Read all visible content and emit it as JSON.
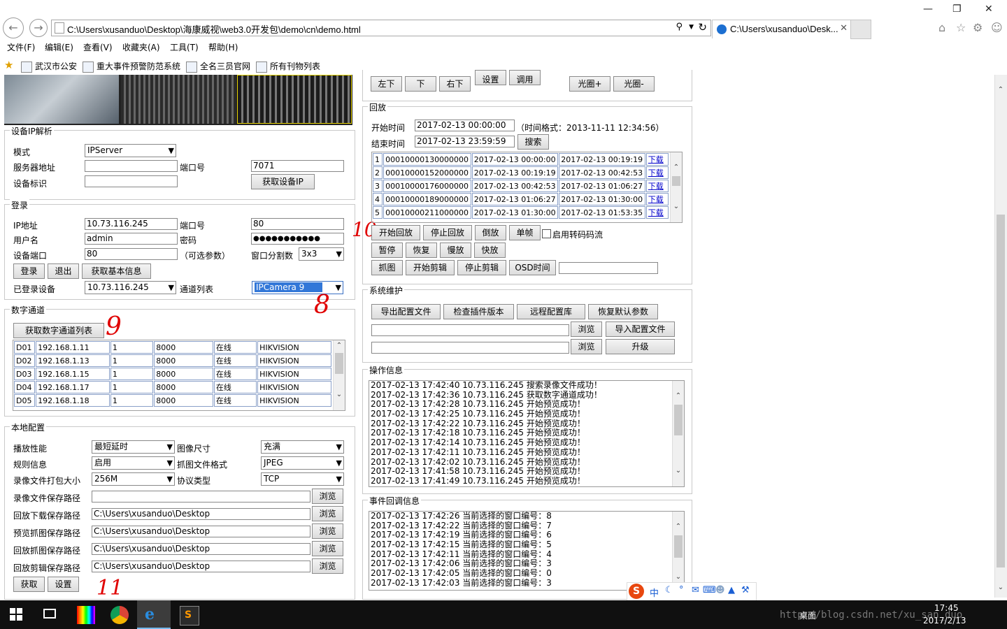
{
  "browser": {
    "address": "C:\\Users\\xusanduo\\Desktop\\海康威视\\web3.0开发包\\demo\\cn\\demo.html",
    "tab_title": "C:\\Users\\xusanduo\\Desk...",
    "menu": [
      "文件(F)",
      "编辑(E)",
      "查看(V)",
      "收藏夹(A)",
      "工具(T)",
      "帮助(H)"
    ],
    "favorites": [
      "武汉市公安",
      "重大事件预警防范系统",
      "全名三员官网",
      "所有刊物列表"
    ]
  },
  "ip_section": {
    "legend": "设备IP解析",
    "mode_label": "模式",
    "mode_value": "IPServer",
    "server_label": "服务器地址",
    "port_label": "端口号",
    "port_value": "7071",
    "device_id_label": "设备标识",
    "get_ip_button": "获取设备IP"
  },
  "login": {
    "legend": "登录",
    "ip_label": "IP地址",
    "ip_value": "10.73.116.245",
    "port_label": "端口号",
    "port_value": "80",
    "user_label": "用户名",
    "user_value": "admin",
    "password_label": "密码",
    "password_value": "●●●●●●●●●●●",
    "device_port_label": "设备端口",
    "device_port_value": "80",
    "optional_note": "（可选参数）",
    "window_split_label": "窗口分割数",
    "window_split_value": "3x3",
    "login_button": "登录",
    "logout_button": "退出",
    "basic_info_button": "获取基本信息",
    "logged_device_label": "已登录设备",
    "logged_device_value": "10.73.116.245",
    "channel_list_label": "通道列表",
    "channel_value": "IPCamera 9"
  },
  "digital_channels": {
    "legend": "数字通道",
    "get_list_button": "获取数字通道列表",
    "rows": [
      [
        "D01",
        "192.168.1.11",
        "1",
        "8000",
        "在线",
        "HIKVISION"
      ],
      [
        "D02",
        "192.168.1.13",
        "1",
        "8000",
        "在线",
        "HIKVISION"
      ],
      [
        "D03",
        "192.168.1.15",
        "1",
        "8000",
        "在线",
        "HIKVISION"
      ],
      [
        "D04",
        "192.168.1.17",
        "1",
        "8000",
        "在线",
        "HIKVISION"
      ],
      [
        "D05",
        "192.168.1.18",
        "1",
        "8000",
        "在线",
        "HIKVISION"
      ]
    ]
  },
  "local_config": {
    "legend": "本地配置",
    "play_perf_label": "播放性能",
    "play_perf_value": "最短延时",
    "image_size_label": "图像尺寸",
    "image_size_value": "充满",
    "rule_info_label": "规则信息",
    "rule_info_value": "启用",
    "capture_format_label": "抓图文件格式",
    "capture_format_value": "JPEG",
    "record_pack_label": "录像文件打包大小",
    "record_pack_value": "256M",
    "protocol_label": "协议类型",
    "protocol_value": "TCP",
    "paths": [
      {
        "label": "录像文件保存路径",
        "value": ""
      },
      {
        "label": "回放下载保存路径",
        "value": "C:\\Users\\xusanduo\\Desktop"
      },
      {
        "label": "预览抓图保存路径",
        "value": "C:\\Users\\xusanduo\\Desktop"
      },
      {
        "label": "回放抓图保存路径",
        "value": "C:\\Users\\xusanduo\\Desktop"
      },
      {
        "label": "回放剪辑保存路径",
        "value": "C:\\Users\\xusanduo\\Desktop"
      }
    ],
    "browse_button": "浏览",
    "get_button": "获取",
    "set_button": "设置"
  },
  "ptz": {
    "left_down": "左下",
    "down": "下",
    "right_down": "右下",
    "set": "设置",
    "call": "调用",
    "iris_plus": "光圈+",
    "iris_minus": "光圈-"
  },
  "playback": {
    "legend": "回放",
    "start_label": "开始时间",
    "start_value": "2017-02-13 00:00:00",
    "format_note": "（时间格式：2013-11-11 12:34:56）",
    "end_label": "结束时间",
    "end_value": "2017-02-13 23:59:59",
    "search_button": "搜索",
    "download_label": "下载",
    "rows": [
      [
        "1",
        "00010000130000000",
        "2017-02-13 00:00:00",
        "2017-02-13 00:19:19"
      ],
      [
        "2",
        "00010000152000000",
        "2017-02-13 00:19:19",
        "2017-02-13 00:42:53"
      ],
      [
        "3",
        "00010000176000000",
        "2017-02-13 00:42:53",
        "2017-02-13 01:06:27"
      ],
      [
        "4",
        "00010000189000000",
        "2017-02-13 01:06:27",
        "2017-02-13 01:30:00"
      ],
      [
        "5",
        "00010000211000000",
        "2017-02-13 01:30:00",
        "2017-02-13 01:53:35"
      ]
    ],
    "start_playback": "开始回放",
    "stop_playback": "停止回放",
    "reverse": "倒放",
    "single_frame": "单帧",
    "transcode_label": "启用转码码流",
    "pause": "暂停",
    "resume": "恢复",
    "slow": "慢放",
    "fast": "快放",
    "capture": "抓图",
    "start_clip": "开始剪辑",
    "stop_clip": "停止剪辑",
    "osd_time": "OSD时间"
  },
  "maintenance": {
    "legend": "系统维护",
    "export_config": "导出配置文件",
    "check_plugin": "检查插件版本",
    "remote_config": "远程配置库",
    "restore_default": "恢复默认参数",
    "browse": "浏览",
    "import_config": "导入配置文件",
    "upgrade": "升级"
  },
  "op_info": {
    "legend": "操作信息",
    "lines": [
      "2017-02-13 17:42:40 10.73.116.245 搜索录像文件成功！",
      "2017-02-13 17:42:36 10.73.116.245 获取数字通道成功！",
      "2017-02-13 17:42:28 10.73.116.245 开始预览成功！",
      "2017-02-13 17:42:25 10.73.116.245 开始预览成功！",
      "2017-02-13 17:42:22 10.73.116.245 开始预览成功！",
      "2017-02-13 17:42:18 10.73.116.245 开始预览成功！",
      "2017-02-13 17:42:14 10.73.116.245 开始预览成功！",
      "2017-02-13 17:42:11 10.73.116.245 开始预览成功！",
      "2017-02-13 17:42:02 10.73.116.245 开始预览成功！",
      "2017-02-13 17:41:58 10.73.116.245 开始预览成功！",
      "2017-02-13 17:41:49 10.73.116.245 开始预览成功！"
    ]
  },
  "event_info": {
    "legend": "事件回调信息",
    "lines": [
      "2017-02-13 17:42:26 当前选择的窗口编号：8",
      "2017-02-13 17:42:22 当前选择的窗口编号：7",
      "2017-02-13 17:42:19 当前选择的窗口编号：6",
      "2017-02-13 17:42:15 当前选择的窗口编号：5",
      "2017-02-13 17:42:11 当前选择的窗口编号：4",
      "2017-02-13 17:42:06 当前选择的窗口编号：3",
      "2017-02-13 17:42:05 当前选择的窗口编号：0",
      "2017-02-13 17:42:03 当前选择的窗口编号：3"
    ]
  },
  "annotations": {
    "a8": "8",
    "a9": "9",
    "a10": "10",
    "a11": "11"
  },
  "ime": {
    "lang": "中"
  },
  "taskbar": {
    "desktop": "桌面",
    "time": "17:45",
    "date": "2017/2/13",
    "watermark": "http://blog.csdn.net/xu_san_duo"
  }
}
